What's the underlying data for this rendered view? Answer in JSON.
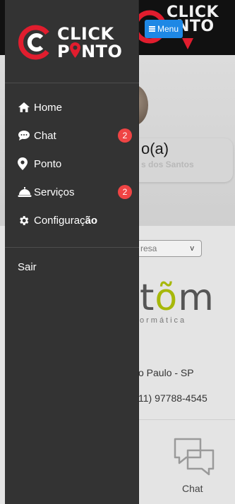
{
  "background": {
    "header_logo_text_line1": "CLICK",
    "header_logo_text_line2": "NTO",
    "menu_button_label": "Menu",
    "greeting": "o(a)",
    "user_name_partial": "s dos Santos",
    "select_placeholder": "resa",
    "brand_name_left": "t",
    "brand_name_accent": "õ",
    "brand_name_right": "m",
    "brand_tagline": "ormática",
    "city": "o Paulo - SP",
    "phone": "11) 97788-4545",
    "chat_label": "Chat"
  },
  "drawer": {
    "logo_line1": "CLICK",
    "logo_line2_prefix": "P",
    "logo_line2_suffix": "NTO",
    "items": [
      {
        "label": "Home",
        "icon": "home-icon",
        "badge": null
      },
      {
        "label": "Chat",
        "icon": "chat-bubble-icon",
        "badge": "2"
      },
      {
        "label": "Ponto",
        "icon": "map-pin-icon",
        "badge": null
      },
      {
        "label": "Serviços",
        "icon": "service-bell-icon",
        "badge": "2"
      },
      {
        "label": "Configuraç",
        "label_tail": "ão",
        "icon": "gear-icon",
        "badge": null
      }
    ],
    "logout_label": "Sair"
  },
  "colors": {
    "drawer_bg": "#333333",
    "brand_red": "#e11d2e",
    "badge": "#ef4444",
    "menu_button": "#1e88e5",
    "brand_accent": "#a7b80a"
  }
}
